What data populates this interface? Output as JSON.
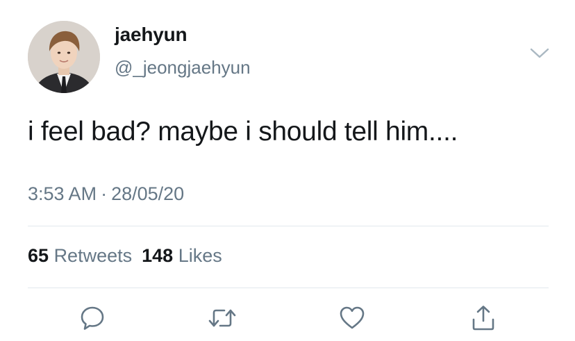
{
  "user": {
    "display_name": "jaehyun",
    "handle": "@_jeongjaehyun"
  },
  "tweet": {
    "text": "i feel bad? maybe i should tell him....",
    "time": "3:53 AM",
    "separator": "·",
    "date": "28/05/20"
  },
  "stats": {
    "retweets_count": "65",
    "retweets_label": "Retweets",
    "likes_count": "148",
    "likes_label": "Likes"
  },
  "icons": {
    "menu": "chevron-down-icon",
    "reply": "reply-icon",
    "retweet": "retweet-icon",
    "like": "heart-icon",
    "share": "share-icon"
  },
  "colors": {
    "text": "#14171a",
    "secondary": "#657786",
    "divider": "#e1e8ed",
    "background": "#ffffff"
  }
}
